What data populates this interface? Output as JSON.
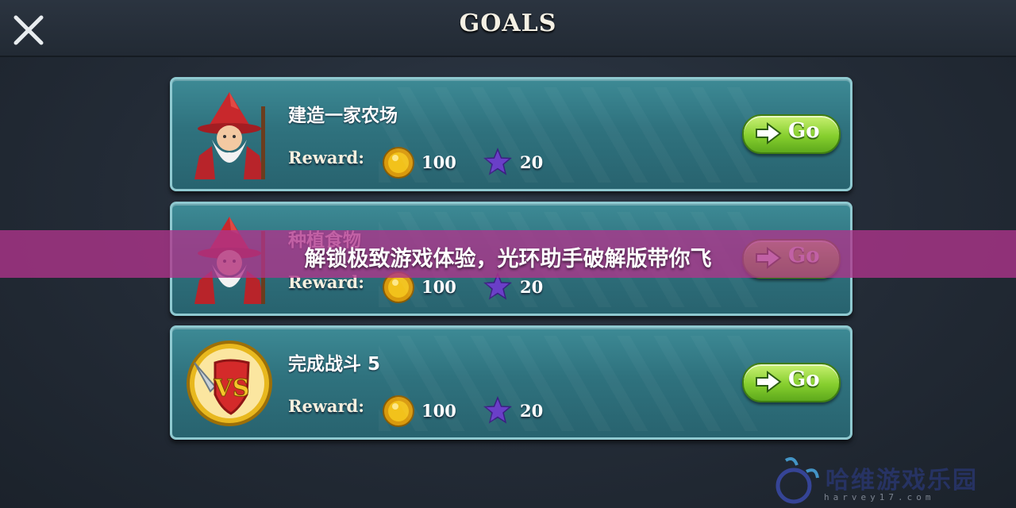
{
  "header": {
    "title": "GOALS",
    "close_icon": "close-x-icon"
  },
  "goals": [
    {
      "name": "建造一家农场",
      "portrait_icon": "wizard-portrait-icon",
      "reward_label": "Reward:",
      "coins": "100",
      "stars": "20",
      "go_label": "Go"
    },
    {
      "name": "种植食物",
      "portrait_icon": "wizard-portrait-icon",
      "reward_label": "Reward:",
      "coins": "100",
      "stars": "20",
      "go_label": "Go"
    },
    {
      "name": "完成战斗 5",
      "portrait_icon": "vs-shield-icon",
      "reward_label": "Reward:",
      "coins": "100",
      "stars": "20",
      "go_label": "Go"
    }
  ],
  "overlay_banner": {
    "text": "解锁极致游戏体验，光环助手破解版带你飞",
    "color": "#b0348c"
  },
  "watermark": {
    "name": "哈维游戏乐园",
    "url": "harvey17.com"
  },
  "colors": {
    "card": "#2f727e",
    "card_border": "#8fc9d0",
    "go_button": "#86cf2e",
    "coin": "#f2c21b",
    "star": "#6a3fc8"
  }
}
